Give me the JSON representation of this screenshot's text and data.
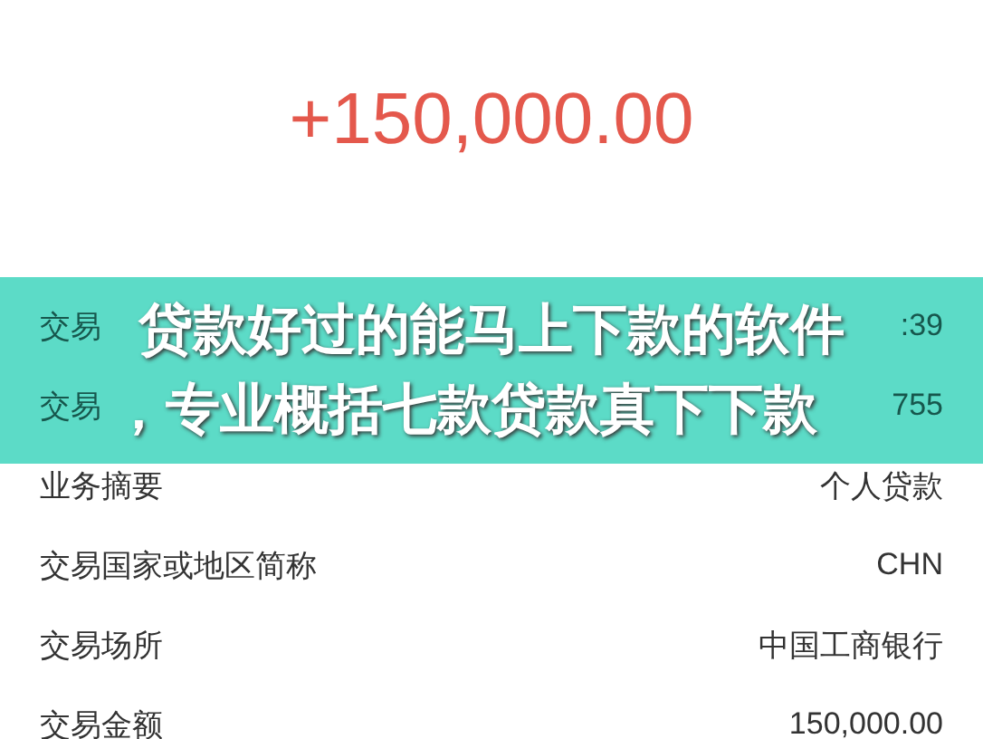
{
  "amount": "+150,000.00",
  "rows": [
    {
      "label": "交易",
      "value": ":39"
    },
    {
      "label": "交易",
      "value": "755"
    },
    {
      "label": "业务摘要",
      "value": "个人贷款"
    },
    {
      "label": "交易国家或地区简称",
      "value": "CHN"
    },
    {
      "label": "交易场所",
      "value": "中国工商银行"
    },
    {
      "label": "交易金额",
      "value": "150,000.00"
    }
  ],
  "banner": {
    "lines": [
      "贷款好过的能马上下款的软件",
      "，专业概括七款贷款真下下款"
    ]
  }
}
